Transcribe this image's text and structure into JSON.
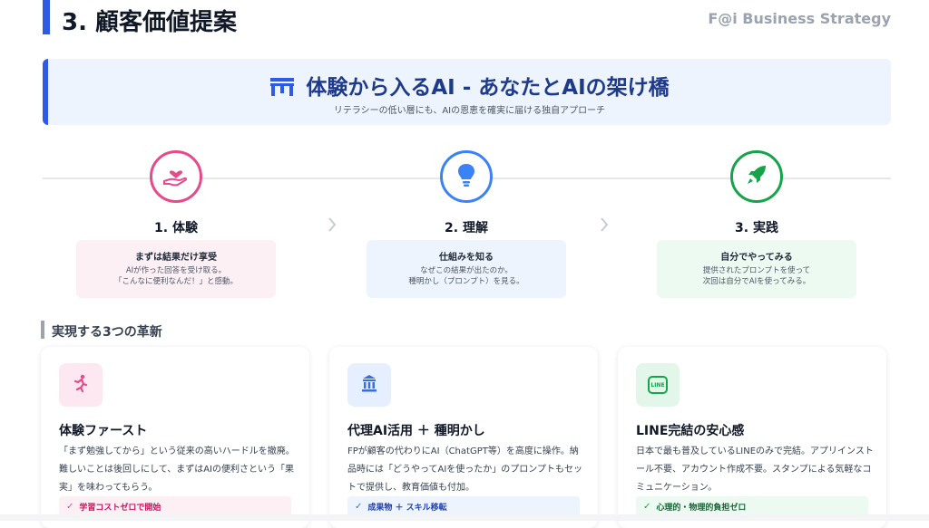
{
  "header": {
    "title": "3. 顧客価値提案",
    "brand": "F@i Business Strategy"
  },
  "banner": {
    "title": "体験から入るAI ‐ あなたとAIの架け橋",
    "subtitle": "リテラシーの低い層にも、AIの恩恵を確実に届ける独自アプローチ"
  },
  "steps": [
    {
      "title": "1. 体験",
      "heading": "まずは結果だけ享受",
      "line1": "AIが作った回答を受け取る。",
      "line2": "「こんなに便利なんだ！」と感動。",
      "icon": "hand-heart-icon",
      "color": "#e64a8b"
    },
    {
      "title": "2. 理解",
      "heading": "仕組みを知る",
      "line1": "なぜこの結果が出たのか。",
      "line2": "種明かし（プロンプト）を見る。",
      "icon": "lightbulb-icon",
      "color": "#3b82f6"
    },
    {
      "title": "3. 実践",
      "heading": "自分でやってみる",
      "line1": "提供されたプロンプトを使って",
      "line2": "次回は自分でAIを使ってみる。",
      "icon": "rocket-icon",
      "color": "#16a34a"
    }
  ],
  "section": {
    "title": "実現する3つの革新"
  },
  "cards": [
    {
      "title": "体験ファースト",
      "desc": "「まず勉強してから」という従来の高いハードルを撤廃。難しいことは後回しにして、まずはAIの便利さという「果実」を味わってもらう。",
      "badge": "学習コストゼロで開始",
      "icon": "running-person-icon"
    },
    {
      "title": "代理AI活用 ＋ 種明かし",
      "desc": "FPが顧客の代わりにAI（ChatGPT等）を高度に操作。納品時には「どうやってAIを使ったか」のプロンプトもセットで提供し、教育価値も付加。",
      "badge": "成果物 ＋ スキル移転",
      "icon": "building-icon"
    },
    {
      "title": "LINE完結の安心感",
      "desc": "日本で最も普及しているLINEのみで完結。アプリインストール不要、アカウント作成不要。スタンプによる気軽なコミュニケーション。",
      "badge": "心理的・物理的負担ゼロ",
      "icon": "line-app-icon",
      "icon_text": "LINE"
    }
  ],
  "colors": {
    "accent": "#2d5be3",
    "pink": "#e64a8b",
    "blue": "#3b82f6",
    "green": "#16a34a"
  }
}
